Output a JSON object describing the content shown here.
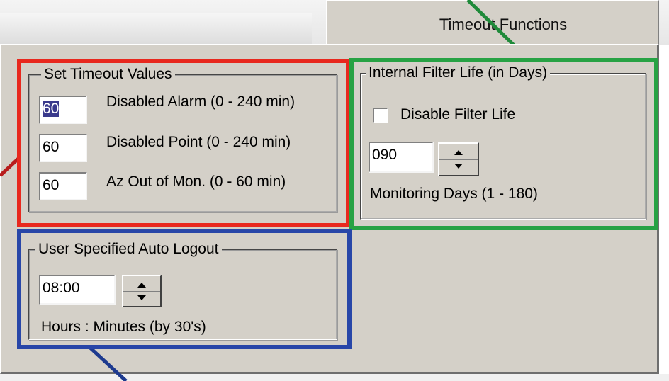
{
  "tab": {
    "label": "Timeout Functions"
  },
  "timeout_values": {
    "title": "Set Timeout Values",
    "rows": [
      {
        "value": "60",
        "label": "Disabled Alarm (0 - 240 min)",
        "selected": true
      },
      {
        "value": "60",
        "label": "Disabled Point (0 - 240 min)",
        "selected": false
      },
      {
        "value": "60",
        "label": "Az Out of Mon. (0 - 60 min)",
        "selected": false
      }
    ]
  },
  "filter_life": {
    "title": "Internal Filter Life (in Days)",
    "checkbox_label": "Disable Filter Life",
    "checkbox_checked": false,
    "days_value": "090",
    "caption": "Monitoring Days (1 - 180)"
  },
  "auto_logout": {
    "title": "User Specified  Auto Logout",
    "time_value": "08:00",
    "caption": "Hours : Minutes   (by 30's)"
  },
  "colors": {
    "panel_bg": "#d4d0c8",
    "highlight_red": "#e8281e",
    "highlight_green": "#27a244",
    "highlight_blue": "#2846a8",
    "selection": "#3a3a8c"
  }
}
